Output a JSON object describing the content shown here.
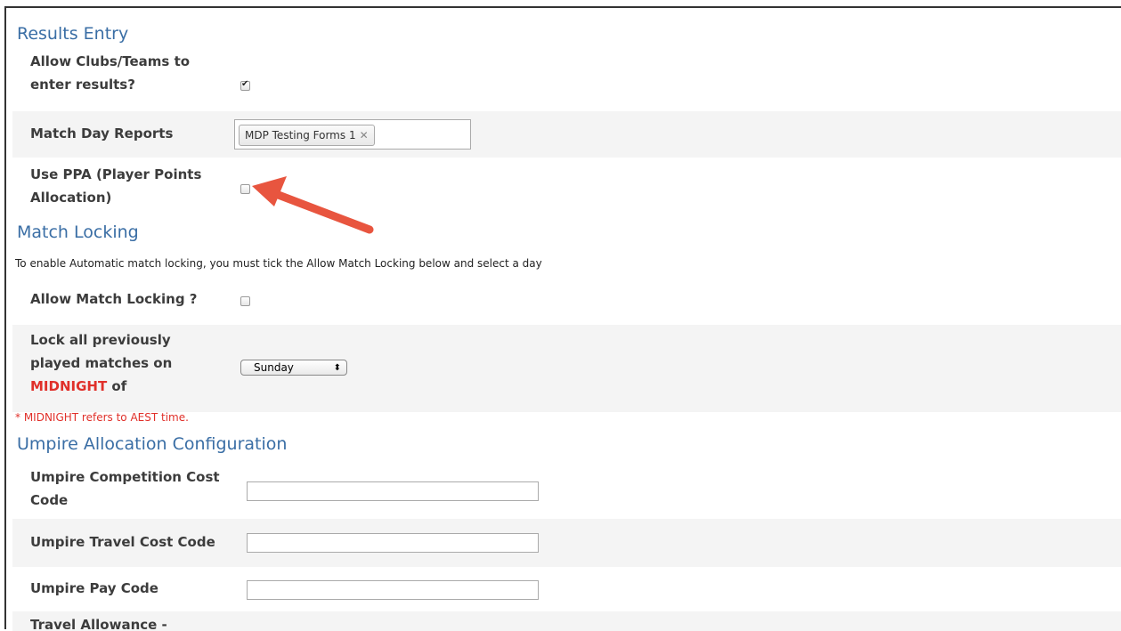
{
  "results_entry": {
    "heading": "Results Entry",
    "allow_clubs_label_line1": "Allow Clubs/Teams to",
    "allow_clubs_label_line2": "enter results?",
    "allow_clubs_checked": true,
    "match_day_reports_label": "Match Day Reports",
    "match_day_reports_tag": "MDP Testing Forms 1",
    "tag_remove_glyph": "✕",
    "ppa_label_line1": "Use PPA (Player Points",
    "ppa_label_line2": "Allocation)",
    "ppa_checked": false
  },
  "match_locking": {
    "heading": "Match Locking",
    "instructions": "To enable Automatic match locking, you must tick the Allow Match Locking below and select a day",
    "allow_label": "Allow Match Locking ?",
    "allow_checked": false,
    "lock_label_line1": "Lock all previously",
    "lock_label_line2": "played matches on",
    "lock_label_midnight": "MIDNIGHT",
    "lock_label_of": " of",
    "day_selected": "Sunday",
    "select_arrow_glyph": "⬍",
    "midnight_note": "* MIDNIGHT refers to AEST time."
  },
  "umpire": {
    "heading": "Umpire Allocation Configuration",
    "competition_cost_line1": "Umpire Competition Cost",
    "competition_cost_line2": "Code",
    "competition_cost_value": "",
    "travel_cost_label": "Umpire Travel Cost Code",
    "travel_cost_value": "",
    "pay_code_label": "Umpire Pay Code",
    "pay_code_value": "",
    "travel_allowance_label": "Travel Allowance -"
  },
  "colors": {
    "heading": "#3a6ea5",
    "alert": "#e0302a",
    "arrow": "#e8553f"
  }
}
